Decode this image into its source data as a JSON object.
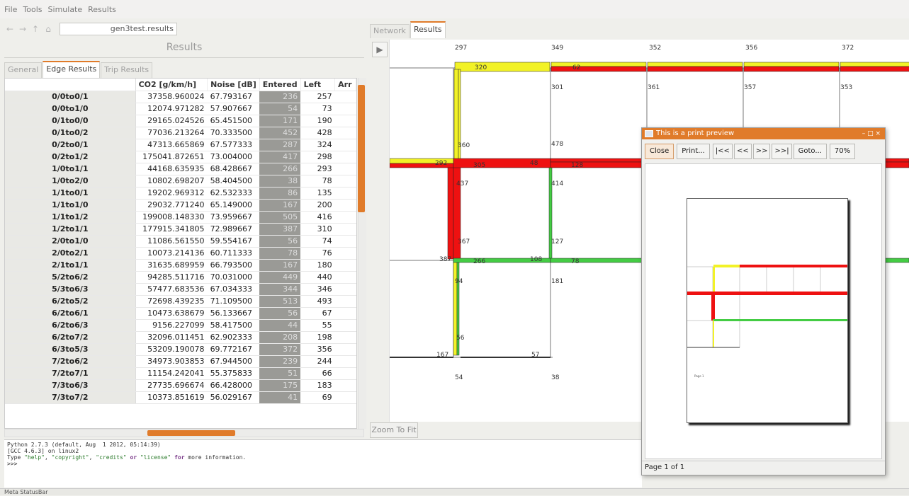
{
  "menubar": {
    "items": [
      "File",
      "Tools",
      "Simulate",
      "Results"
    ]
  },
  "nav": {
    "url": "gen3test.results",
    "back_icon": "arrow-left-icon",
    "forward_icon": "arrow-right-icon",
    "up_icon": "arrow-up-icon",
    "home_icon": "home-icon"
  },
  "left": {
    "title": "Results",
    "tabs": [
      "General",
      "Edge Results",
      "Trip Results"
    ],
    "table": {
      "headers": [
        "CO2 [g/km/h]",
        "Noise [dB]",
        "Entered",
        "Left",
        "Arr"
      ],
      "rows": [
        [
          "0/0to0/1",
          "37358.960024",
          "67.793167",
          "236",
          "257"
        ],
        [
          "0/0to1/0",
          "12074.971282",
          "57.907667",
          "54",
          "73"
        ],
        [
          "0/1to0/0",
          "29165.024526",
          "65.451500",
          "171",
          "190"
        ],
        [
          "0/1to0/2",
          "77036.213264",
          "70.333500",
          "452",
          "428"
        ],
        [
          "0/2to0/1",
          "47313.665869",
          "67.577333",
          "287",
          "324"
        ],
        [
          "0/2to1/2",
          "175041.872651",
          "73.004000",
          "417",
          "298"
        ],
        [
          "1/0to1/1",
          "44168.635935",
          "68.428667",
          "266",
          "293"
        ],
        [
          "1/0to2/0",
          "10802.698207",
          "58.404500",
          "38",
          "78"
        ],
        [
          "1/1to0/1",
          "19202.969312",
          "62.532333",
          "86",
          "135"
        ],
        [
          "1/1to1/0",
          "29032.771240",
          "65.149000",
          "167",
          "200"
        ],
        [
          "1/1to1/2",
          "199008.148330",
          "73.959667",
          "505",
          "416"
        ],
        [
          "1/2to1/1",
          "177915.341805",
          "72.989667",
          "387",
          "310"
        ],
        [
          "2/0to1/0",
          "11086.561550",
          "59.554167",
          "56",
          "74"
        ],
        [
          "2/0to2/1",
          "10073.214136",
          "60.711333",
          "78",
          "76"
        ],
        [
          "2/1to1/1",
          "31635.689959",
          "66.793500",
          "167",
          "180"
        ],
        [
          "5/2to6/2",
          "94285.511716",
          "70.031000",
          "449",
          "440"
        ],
        [
          "5/3to6/3",
          "57477.683536",
          "67.034333",
          "344",
          "346"
        ],
        [
          "6/2to5/2",
          "72698.439235",
          "71.109500",
          "513",
          "493"
        ],
        [
          "6/2to6/1",
          "10473.638679",
          "56.133667",
          "56",
          "67"
        ],
        [
          "6/2to6/3",
          "9156.227099",
          "58.417500",
          "44",
          "55"
        ],
        [
          "6/2to7/2",
          "32096.011451",
          "62.902333",
          "208",
          "198"
        ],
        [
          "6/3to5/3",
          "53209.190078",
          "69.772167",
          "372",
          "356"
        ],
        [
          "7/2to6/2",
          "34973.903853",
          "67.944500",
          "239",
          "244"
        ],
        [
          "7/2to7/1",
          "11154.242041",
          "55.375833",
          "51",
          "66"
        ],
        [
          "7/3to6/3",
          "27735.696674",
          "66.428000",
          "175",
          "183"
        ],
        [
          "7/3to7/2",
          "10373.851619",
          "56.029167",
          "41",
          "69"
        ]
      ]
    }
  },
  "right": {
    "tabs": [
      "Network",
      "Results"
    ],
    "zoom_fit": "Zoom To Fit",
    "network_labels": [
      "297",
      "349",
      "352",
      "356",
      "372",
      "320",
      "62",
      "301",
      "361",
      "357",
      "353",
      "360",
      "478",
      "292",
      "305",
      "48",
      "128",
      "437",
      "414",
      "367",
      "127",
      "387",
      "266",
      "108",
      "78",
      "94",
      "181",
      "56",
      "167",
      "57",
      "54",
      "38"
    ]
  },
  "console": {
    "line1": "Python 2.7.3 (default, Aug  1 2012, 05:14:39)",
    "line2": "[GCC 4.6.3] on linux2",
    "line3_a": "Type ",
    "line3_s1": "\"help\"",
    "line3_b": ", ",
    "line3_s2": "\"copyright\"",
    "line3_c": ", ",
    "line3_s3": "\"credits\"",
    "line3_or": " or ",
    "line3_s4": "\"license\"",
    "line3_for": " for",
    "line3_end": " more information.",
    "line4": ">>>"
  },
  "statusbar": {
    "text": "Meta StatusBar"
  },
  "preview": {
    "title": "This is a print preview",
    "buttons": {
      "close": "Close",
      "print": "Print...",
      "first": "|<<",
      "prev": "<<",
      "next": ">>",
      "last": ">>|",
      "goto": "Goto...",
      "zoom": "70%"
    },
    "status": "Page 1 of 1",
    "page_label": "Page 1"
  },
  "colors": {
    "accent": "#e07b2a",
    "road_red": "#ee1111",
    "road_yellow": "#f2f227",
    "road_green": "#44cc44"
  }
}
